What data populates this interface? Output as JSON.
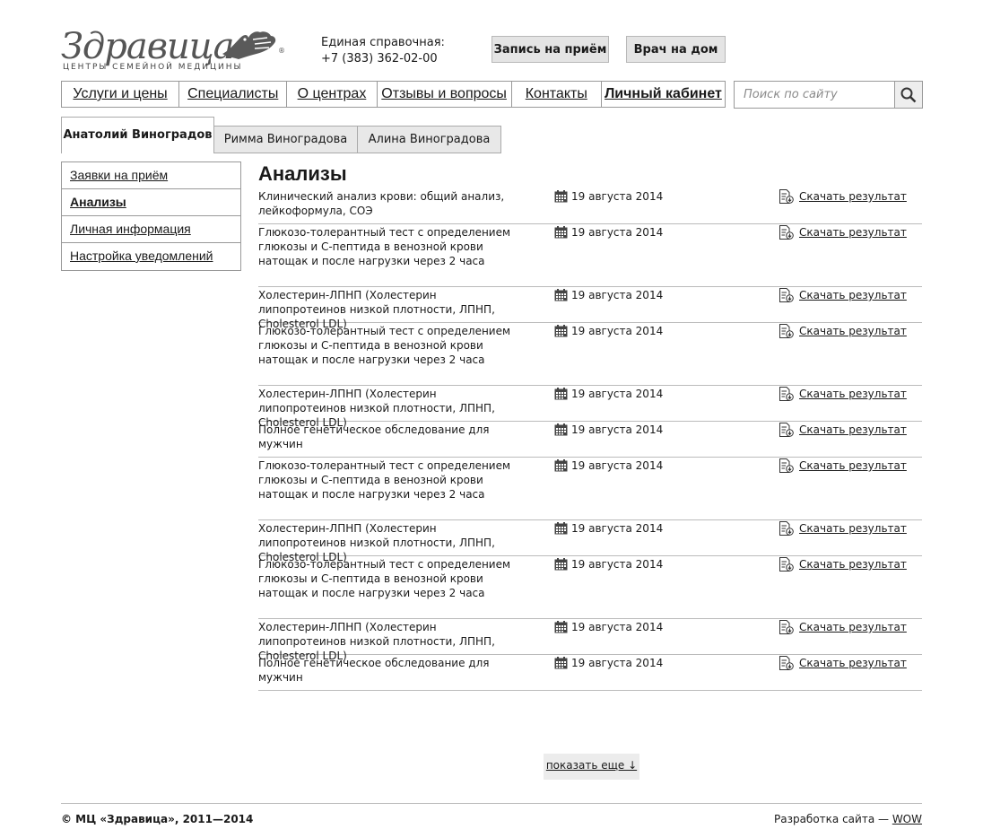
{
  "header": {
    "logo_text": "Здравица",
    "logo_tagline": "ЦЕНТРЫ СЕМЕЙНОЙ МЕДИЦИНЫ",
    "hotline_label": "Единая справочная:",
    "hotline_phone": "+7 (383) 362-02-00",
    "appointment_button": "Запись на приём",
    "home_doctor_button": "Врач на дом"
  },
  "nav": {
    "items": [
      {
        "label": "Услуги и цены"
      },
      {
        "label": "Специалисты"
      },
      {
        "label": "О центрах"
      },
      {
        "label": "Отзывы и вопросы"
      },
      {
        "label": "Контакты"
      },
      {
        "label": "Личный кабинет"
      }
    ]
  },
  "search": {
    "placeholder": "Поиск по сайту",
    "icon": "search-icon"
  },
  "tabs": [
    {
      "label": "Анатолий Виноградов",
      "active": true
    },
    {
      "label": "Римма Виноградова"
    },
    {
      "label": "Алина Виноградова"
    }
  ],
  "sidebar": {
    "items": [
      {
        "label": "Заявки на приём"
      },
      {
        "label": "Анализы",
        "active": true
      },
      {
        "label": "Личная информация"
      },
      {
        "label": "Настройка уведомлений"
      }
    ]
  },
  "main": {
    "title": "Анализы",
    "download_label": "Скачать результат",
    "more_label": "показать еще ↓",
    "rows": [
      {
        "name": "Клинический анализ крови: общий анализ, лейкоформула, СОЭ",
        "date": "19 августа 2014"
      },
      {
        "name": "Глюкозо-толерантный тест с определением глюкозы и С-пептида в венозной крови натощак и после нагрузки через 2 часа",
        "date": "19 августа 2014"
      },
      {
        "name": "Холестерин-ЛПНП (Холестерин липопротеинов низкой плотности, ЛПНП, Cholesterol LDL)",
        "date": "19 августа 2014"
      },
      {
        "name": "Глюкозо-толерантный тест с определением глюкозы и С-пептида в венозной крови натощак и после нагрузки через 2 часа",
        "date": "19 августа 2014"
      },
      {
        "name": "Холестерин-ЛПНП (Холестерин липопротеинов низкой плотности, ЛПНП, Cholesterol LDL)",
        "date": "19 августа 2014"
      },
      {
        "name": "Полное генетическое обследование для мужчин",
        "date": "19 августа 2014"
      },
      {
        "name": "Глюкозо-толерантный тест с определением глюкозы и С-пептида в венозной крови натощак и после нагрузки через 2 часа",
        "date": "19 августа 2014"
      },
      {
        "name": "Холестерин-ЛПНП (Холестерин липопротеинов низкой плотности, ЛПНП, Cholesterol LDL)",
        "date": "19 августа 2014"
      },
      {
        "name": "Глюкозо-толерантный тест с определением глюкозы и С-пептида в венозной крови натощак и после нагрузки через 2 часа",
        "date": "19 августа 2014"
      },
      {
        "name": "Холестерин-ЛПНП (Холестерин липопротеинов низкой плотности, ЛПНП, Cholesterol LDL)",
        "date": "19 августа 2014"
      },
      {
        "name": "Полное генетическое обследование для мужчин",
        "date": "19 августа 2014"
      }
    ]
  },
  "footer": {
    "copyright": "© МЦ «Здравица», 2011—2014",
    "dev_label": "Разработка сайта —",
    "dev_link": "WOW"
  }
}
